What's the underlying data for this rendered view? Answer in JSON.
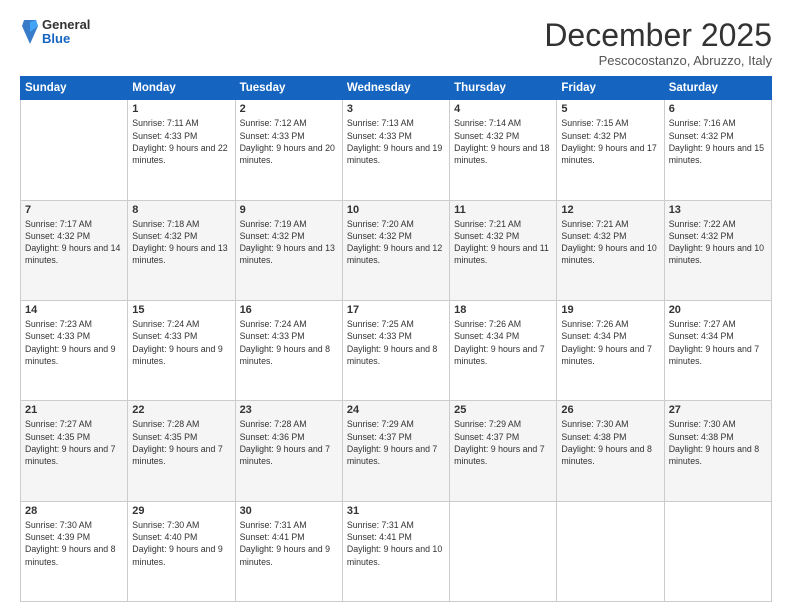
{
  "header": {
    "logo": {
      "general": "General",
      "blue": "Blue"
    },
    "title": "December 2025",
    "location": "Pescocostanzo, Abruzzo, Italy"
  },
  "weekdays": [
    "Sunday",
    "Monday",
    "Tuesday",
    "Wednesday",
    "Thursday",
    "Friday",
    "Saturday"
  ],
  "weeks": [
    [
      {
        "day": "",
        "sunrise": "",
        "sunset": "",
        "daylight": ""
      },
      {
        "day": "1",
        "sunrise": "Sunrise: 7:11 AM",
        "sunset": "Sunset: 4:33 PM",
        "daylight": "Daylight: 9 hours and 22 minutes."
      },
      {
        "day": "2",
        "sunrise": "Sunrise: 7:12 AM",
        "sunset": "Sunset: 4:33 PM",
        "daylight": "Daylight: 9 hours and 20 minutes."
      },
      {
        "day": "3",
        "sunrise": "Sunrise: 7:13 AM",
        "sunset": "Sunset: 4:33 PM",
        "daylight": "Daylight: 9 hours and 19 minutes."
      },
      {
        "day": "4",
        "sunrise": "Sunrise: 7:14 AM",
        "sunset": "Sunset: 4:32 PM",
        "daylight": "Daylight: 9 hours and 18 minutes."
      },
      {
        "day": "5",
        "sunrise": "Sunrise: 7:15 AM",
        "sunset": "Sunset: 4:32 PM",
        "daylight": "Daylight: 9 hours and 17 minutes."
      },
      {
        "day": "6",
        "sunrise": "Sunrise: 7:16 AM",
        "sunset": "Sunset: 4:32 PM",
        "daylight": "Daylight: 9 hours and 15 minutes."
      }
    ],
    [
      {
        "day": "7",
        "sunrise": "Sunrise: 7:17 AM",
        "sunset": "Sunset: 4:32 PM",
        "daylight": "Daylight: 9 hours and 14 minutes."
      },
      {
        "day": "8",
        "sunrise": "Sunrise: 7:18 AM",
        "sunset": "Sunset: 4:32 PM",
        "daylight": "Daylight: 9 hours and 13 minutes."
      },
      {
        "day": "9",
        "sunrise": "Sunrise: 7:19 AM",
        "sunset": "Sunset: 4:32 PM",
        "daylight": "Daylight: 9 hours and 13 minutes."
      },
      {
        "day": "10",
        "sunrise": "Sunrise: 7:20 AM",
        "sunset": "Sunset: 4:32 PM",
        "daylight": "Daylight: 9 hours and 12 minutes."
      },
      {
        "day": "11",
        "sunrise": "Sunrise: 7:21 AM",
        "sunset": "Sunset: 4:32 PM",
        "daylight": "Daylight: 9 hours and 11 minutes."
      },
      {
        "day": "12",
        "sunrise": "Sunrise: 7:21 AM",
        "sunset": "Sunset: 4:32 PM",
        "daylight": "Daylight: 9 hours and 10 minutes."
      },
      {
        "day": "13",
        "sunrise": "Sunrise: 7:22 AM",
        "sunset": "Sunset: 4:32 PM",
        "daylight": "Daylight: 9 hours and 10 minutes."
      }
    ],
    [
      {
        "day": "14",
        "sunrise": "Sunrise: 7:23 AM",
        "sunset": "Sunset: 4:33 PM",
        "daylight": "Daylight: 9 hours and 9 minutes."
      },
      {
        "day": "15",
        "sunrise": "Sunrise: 7:24 AM",
        "sunset": "Sunset: 4:33 PM",
        "daylight": "Daylight: 9 hours and 9 minutes."
      },
      {
        "day": "16",
        "sunrise": "Sunrise: 7:24 AM",
        "sunset": "Sunset: 4:33 PM",
        "daylight": "Daylight: 9 hours and 8 minutes."
      },
      {
        "day": "17",
        "sunrise": "Sunrise: 7:25 AM",
        "sunset": "Sunset: 4:33 PM",
        "daylight": "Daylight: 9 hours and 8 minutes."
      },
      {
        "day": "18",
        "sunrise": "Sunrise: 7:26 AM",
        "sunset": "Sunset: 4:34 PM",
        "daylight": "Daylight: 9 hours and 7 minutes."
      },
      {
        "day": "19",
        "sunrise": "Sunrise: 7:26 AM",
        "sunset": "Sunset: 4:34 PM",
        "daylight": "Daylight: 9 hours and 7 minutes."
      },
      {
        "day": "20",
        "sunrise": "Sunrise: 7:27 AM",
        "sunset": "Sunset: 4:34 PM",
        "daylight": "Daylight: 9 hours and 7 minutes."
      }
    ],
    [
      {
        "day": "21",
        "sunrise": "Sunrise: 7:27 AM",
        "sunset": "Sunset: 4:35 PM",
        "daylight": "Daylight: 9 hours and 7 minutes."
      },
      {
        "day": "22",
        "sunrise": "Sunrise: 7:28 AM",
        "sunset": "Sunset: 4:35 PM",
        "daylight": "Daylight: 9 hours and 7 minutes."
      },
      {
        "day": "23",
        "sunrise": "Sunrise: 7:28 AM",
        "sunset": "Sunset: 4:36 PM",
        "daylight": "Daylight: 9 hours and 7 minutes."
      },
      {
        "day": "24",
        "sunrise": "Sunrise: 7:29 AM",
        "sunset": "Sunset: 4:37 PM",
        "daylight": "Daylight: 9 hours and 7 minutes."
      },
      {
        "day": "25",
        "sunrise": "Sunrise: 7:29 AM",
        "sunset": "Sunset: 4:37 PM",
        "daylight": "Daylight: 9 hours and 7 minutes."
      },
      {
        "day": "26",
        "sunrise": "Sunrise: 7:30 AM",
        "sunset": "Sunset: 4:38 PM",
        "daylight": "Daylight: 9 hours and 8 minutes."
      },
      {
        "day": "27",
        "sunrise": "Sunrise: 7:30 AM",
        "sunset": "Sunset: 4:38 PM",
        "daylight": "Daylight: 9 hours and 8 minutes."
      }
    ],
    [
      {
        "day": "28",
        "sunrise": "Sunrise: 7:30 AM",
        "sunset": "Sunset: 4:39 PM",
        "daylight": "Daylight: 9 hours and 8 minutes."
      },
      {
        "day": "29",
        "sunrise": "Sunrise: 7:30 AM",
        "sunset": "Sunset: 4:40 PM",
        "daylight": "Daylight: 9 hours and 9 minutes."
      },
      {
        "day": "30",
        "sunrise": "Sunrise: 7:31 AM",
        "sunset": "Sunset: 4:41 PM",
        "daylight": "Daylight: 9 hours and 9 minutes."
      },
      {
        "day": "31",
        "sunrise": "Sunrise: 7:31 AM",
        "sunset": "Sunset: 4:41 PM",
        "daylight": "Daylight: 9 hours and 10 minutes."
      },
      {
        "day": "",
        "sunrise": "",
        "sunset": "",
        "daylight": ""
      },
      {
        "day": "",
        "sunrise": "",
        "sunset": "",
        "daylight": ""
      },
      {
        "day": "",
        "sunrise": "",
        "sunset": "",
        "daylight": ""
      }
    ]
  ]
}
